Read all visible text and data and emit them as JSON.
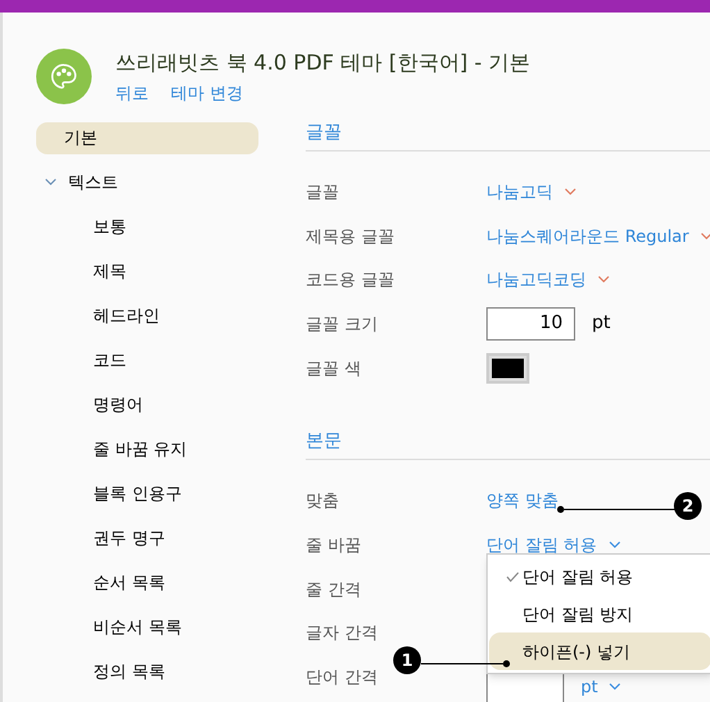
{
  "header": {
    "title": "쓰리래빗츠 북 4.0 PDF 테마 [한국어] - 기본",
    "links": [
      "뒤로",
      "테마 변경"
    ]
  },
  "sidebar": {
    "items": [
      {
        "label": "기본",
        "selected": true
      },
      {
        "label": "텍스트",
        "selected": false,
        "expanded": true,
        "children": [
          {
            "label": "보통",
            "selected": false
          },
          {
            "label": "제목",
            "selected": false
          },
          {
            "label": "헤드라인",
            "selected": false
          },
          {
            "label": "코드",
            "selected": false
          },
          {
            "label": "명령어",
            "selected": false
          },
          {
            "label": "줄 바꿈 유지",
            "selected": false
          },
          {
            "label": "블록 인용구",
            "selected": false
          },
          {
            "label": "권두 명구",
            "selected": false
          },
          {
            "label": "순서 목록",
            "selected": false
          },
          {
            "label": "비순서 목록",
            "selected": false
          },
          {
            "label": "정의 목록",
            "selected": false
          }
        ]
      }
    ]
  },
  "sections": [
    {
      "title": "글꼴",
      "rows": [
        {
          "label": "글꼴",
          "kind": "select",
          "value": "나눔고딕"
        },
        {
          "label": "제목용 글꼴",
          "kind": "select",
          "value": "나눔스퀘어라운드 Regular"
        },
        {
          "label": "코드용 글꼴",
          "kind": "select",
          "value": "나눔고딕코딩"
        },
        {
          "label": "글꼴 크기",
          "kind": "number",
          "value": "10",
          "unit": "pt"
        },
        {
          "label": "글꼴 색",
          "kind": "color",
          "color": "#000000"
        }
      ]
    },
    {
      "title": "본문",
      "rows": [
        {
          "label": "맞춤",
          "kind": "select-nocaret",
          "value": "양쪽 맞춤"
        },
        {
          "label": "줄 바꿈",
          "kind": "select",
          "value": "단어 잘림 허용"
        },
        {
          "label": "줄 간격",
          "kind": "hidden"
        },
        {
          "label": "글자 간격",
          "kind": "hidden"
        },
        {
          "label": "단어 간격",
          "kind": "number-select",
          "unit": "pt"
        }
      ]
    }
  ],
  "menu": {
    "items": [
      {
        "label": "단어 잘림 허용",
        "checked": true,
        "selected": false
      },
      {
        "label": "단어 잘림 방지",
        "checked": false,
        "selected": false
      },
      {
        "label": "하이픈(-) 넣기",
        "checked": false,
        "selected": true
      }
    ]
  },
  "callouts": [
    {
      "number": "2"
    },
    {
      "number": "1"
    }
  ]
}
